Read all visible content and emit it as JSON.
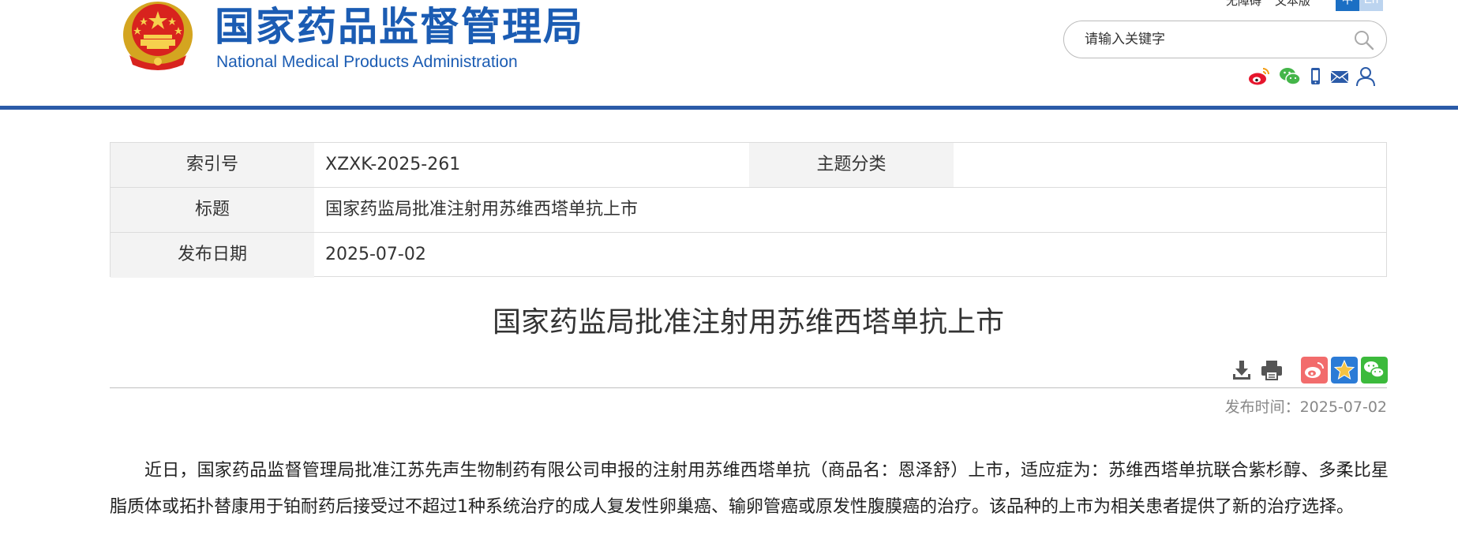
{
  "header": {
    "site_title": "国家药品监督管理局",
    "site_subtitle": "National Medical Products Administration",
    "accessibility_label": "无障碍",
    "print_version_label": "文本版",
    "lang_cn": "中",
    "lang_en": "En",
    "search": {
      "placeholder": "请输入关键字"
    },
    "social_icons": [
      "weibo-icon",
      "wechat-icon",
      "mobile-icon",
      "mail-icon",
      "user-icon"
    ],
    "brand_color": "#1b5cb3",
    "bar_color": "#2b5ba8"
  },
  "meta": {
    "index_label": "索引号",
    "index_value": "XZXK-2025-261",
    "category_label": "主题分类",
    "category_value": "",
    "title_label": "标题",
    "title_value": "国家药监局批准注射用苏维西塔单抗上市",
    "date_label": "发布日期",
    "date_value": "2025-07-02"
  },
  "article": {
    "title": "国家药监局批准注射用苏维西塔单抗上市",
    "publish_label": "发布时间：",
    "publish_value": "2025-07-02",
    "tools": [
      "download-icon",
      "print-icon"
    ],
    "share": [
      "weibo-share-icon",
      "favorite-share-icon",
      "wechat-share-icon"
    ],
    "body": "近日，国家药品监督管理局批准江苏先声生物制药有限公司申报的注射用苏维西塔单抗（商品名：恩泽舒）上市，适应症为：苏维西塔单抗联合紫杉醇、多柔比星脂质体或拓扑替康用于铂耐药后接受过不超过1种系统治疗的成人复发性卵巢癌、输卵管癌或原发性腹膜癌的治疗。该品种的上市为相关患者提供了新的治疗选择。"
  }
}
